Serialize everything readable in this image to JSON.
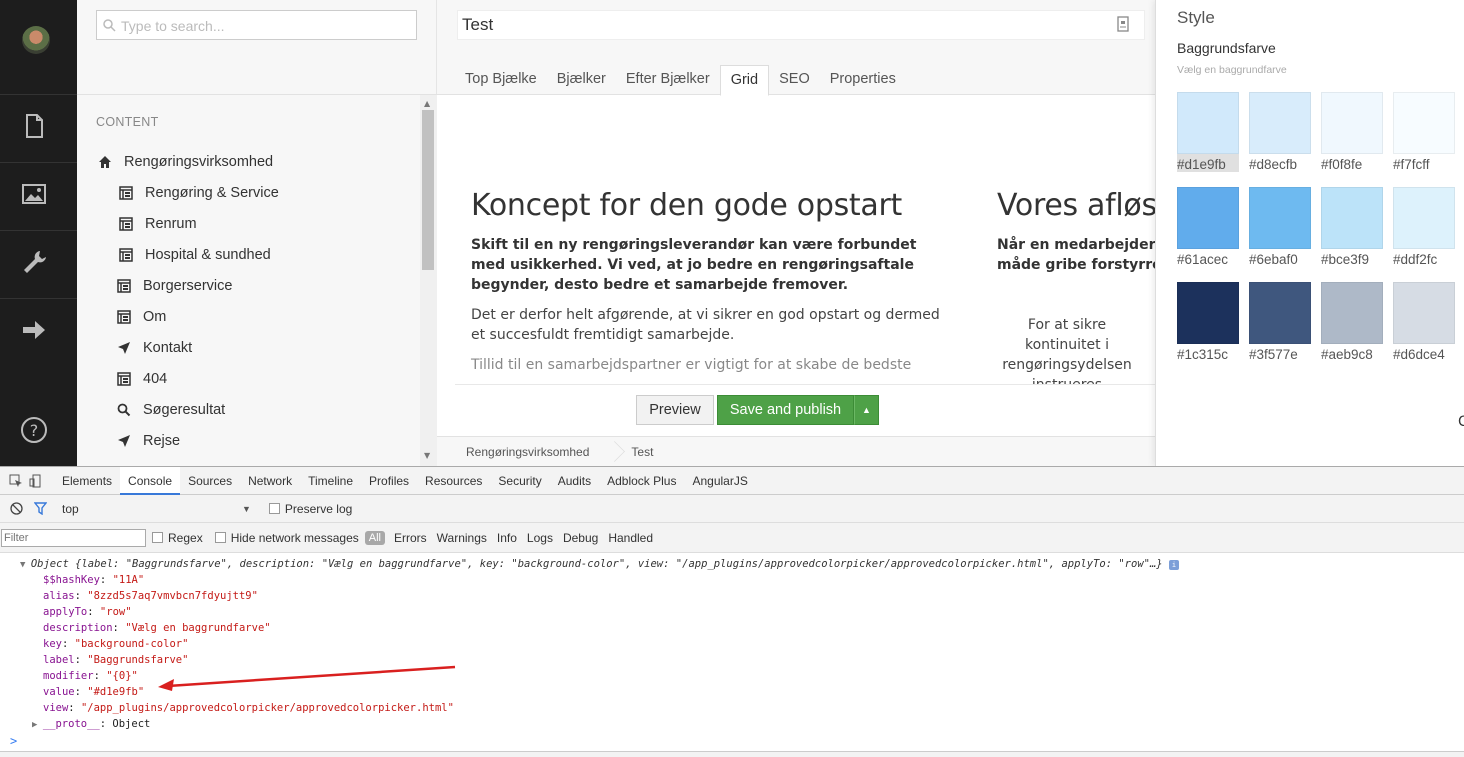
{
  "sidebar": {
    "icons": [
      "content-icon",
      "media-icon",
      "settings-icon",
      "deploy-icon",
      "help-icon"
    ]
  },
  "tree": {
    "search_placeholder": "Type to search...",
    "section_label": "CONTENT",
    "root": "Rengøringsvirksomhed",
    "items": [
      {
        "label": "Rengøring & Service",
        "icon": "page-icon"
      },
      {
        "label": "Renrum",
        "icon": "page-icon"
      },
      {
        "label": "Hospital & sundhed",
        "icon": "page-icon"
      },
      {
        "label": "Borgerservice",
        "icon": "page-icon"
      },
      {
        "label": "Om",
        "icon": "page-icon"
      },
      {
        "label": "Kontakt",
        "icon": "send-icon"
      },
      {
        "label": "404",
        "icon": "page-icon"
      },
      {
        "label": "Søgeresultat",
        "icon": "search-icon"
      },
      {
        "label": "Rejse",
        "icon": "send-icon"
      }
    ]
  },
  "editor": {
    "name": "Test",
    "tabs": [
      "Top Bjælke",
      "Bjælker",
      "Efter Bjælker",
      "Grid",
      "SEO",
      "Properties"
    ],
    "active_tab": "Grid",
    "col1": {
      "heading": "Koncept for den gode opstart",
      "lead": "Skift til en ny rengøringsleverandør kan være forbundet med usikkerhed. Vi ved, at jo bedre en rengøringsaftale begynder, desto bedre et samarbejde fremover.",
      "para1": "Det er derfor helt afgørende, at vi sikrer en god opstart og dermed et succesfuldt fremtidigt samarbejde.",
      "para2": "Tillid til en samarbejdspartner er vigtigt for at skabe de bedste"
    },
    "col2": {
      "heading": "Vores afløs",
      "lead_line1": "Når en medarbejder er",
      "lead_line2": "måde gribe forstyrrend",
      "centered": "For at sikre kontinuitet i rengøringsydelsen instrueres"
    },
    "preview_label": "Preview",
    "publish_label": "Save and publish",
    "breadcrumb": [
      "Rengøringsvirksomhed",
      "Test"
    ]
  },
  "style_panel": {
    "title": "Style",
    "label": "Baggrundsfarve",
    "description": "Vælg en baggrundfarve",
    "selected": "#d1e9fb",
    "swatches": [
      "#d1e9fb",
      "#d8ecfb",
      "#f0f8fe",
      "#f7fcff",
      "#61acec",
      "#6ebaf0",
      "#bce3f9",
      "#ddf2fc",
      "#1c315c",
      "#3f577e",
      "#aeb9c8",
      "#d6dce4"
    ],
    "edge_char": "C"
  },
  "devtools": {
    "tabs": [
      "Elements",
      "Console",
      "Sources",
      "Network",
      "Timeline",
      "Profiles",
      "Resources",
      "Security",
      "Audits",
      "Adblock Plus",
      "AngularJS"
    ],
    "active_tab": "Console",
    "context": "top",
    "preserve_log": "Preserve log",
    "filter_placeholder": "Filter",
    "regex": "Regex",
    "hide_network": "Hide network messages",
    "all": "All",
    "levels": [
      "Errors",
      "Warnings",
      "Info",
      "Logs",
      "Debug",
      "Handled"
    ],
    "summary": {
      "prefix": "Object {",
      "label_key": "label",
      "label_val": "\"Baggrundsfarve\"",
      "description_key": "description",
      "description_val": "\"Vælg en baggrundfarve\"",
      "key_key": "key",
      "key_val": "\"background-color\"",
      "view_key": "view",
      "view_val": "\"/app_plugins/approvedcolorpicker/approvedcolorpicker.html\"",
      "applyto_key": "applyTo",
      "applyto_val": "\"row\"",
      "suffix": "…}"
    },
    "props": [
      {
        "k": "$$hashKey",
        "v": "\"11A\""
      },
      {
        "k": "alias",
        "v": "\"8zzd5s7aq7vmvbcn7fdyujtt9\""
      },
      {
        "k": "applyTo",
        "v": "\"row\""
      },
      {
        "k": "description",
        "v": "\"Vælg en baggrundfarve\""
      },
      {
        "k": "key",
        "v": "\"background-color\""
      },
      {
        "k": "label",
        "v": "\"Baggrundsfarve\""
      },
      {
        "k": "modifier",
        "v": "\"{0}\""
      },
      {
        "k": "value",
        "v": "\"#d1e9fb\""
      },
      {
        "k": "view",
        "v": "\"/app_plugins/approvedcolorpicker/approvedcolorpicker.html\""
      }
    ],
    "proto_key": "__proto__",
    "proto_val": "Object",
    "prompt": ">"
  },
  "colors": {
    "publish_green": "#4ea147",
    "rail_dark": "#1d1d1d",
    "annotation_arrow": "#d9201f"
  }
}
